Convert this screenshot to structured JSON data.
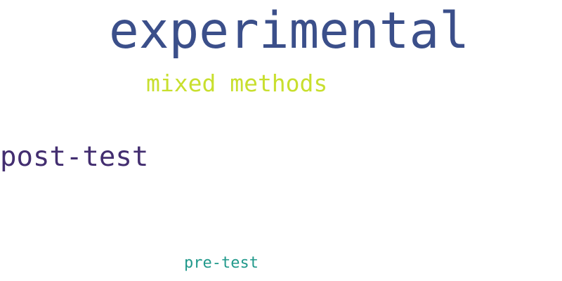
{
  "words": [
    {
      "text": "experimental",
      "color": "#3b4f8a"
    },
    {
      "text": "mixed methods",
      "color": "#c8df2e"
    },
    {
      "text": "post-test",
      "color": "#432e70"
    },
    {
      "text": "pre-test",
      "color": "#21998b"
    }
  ]
}
